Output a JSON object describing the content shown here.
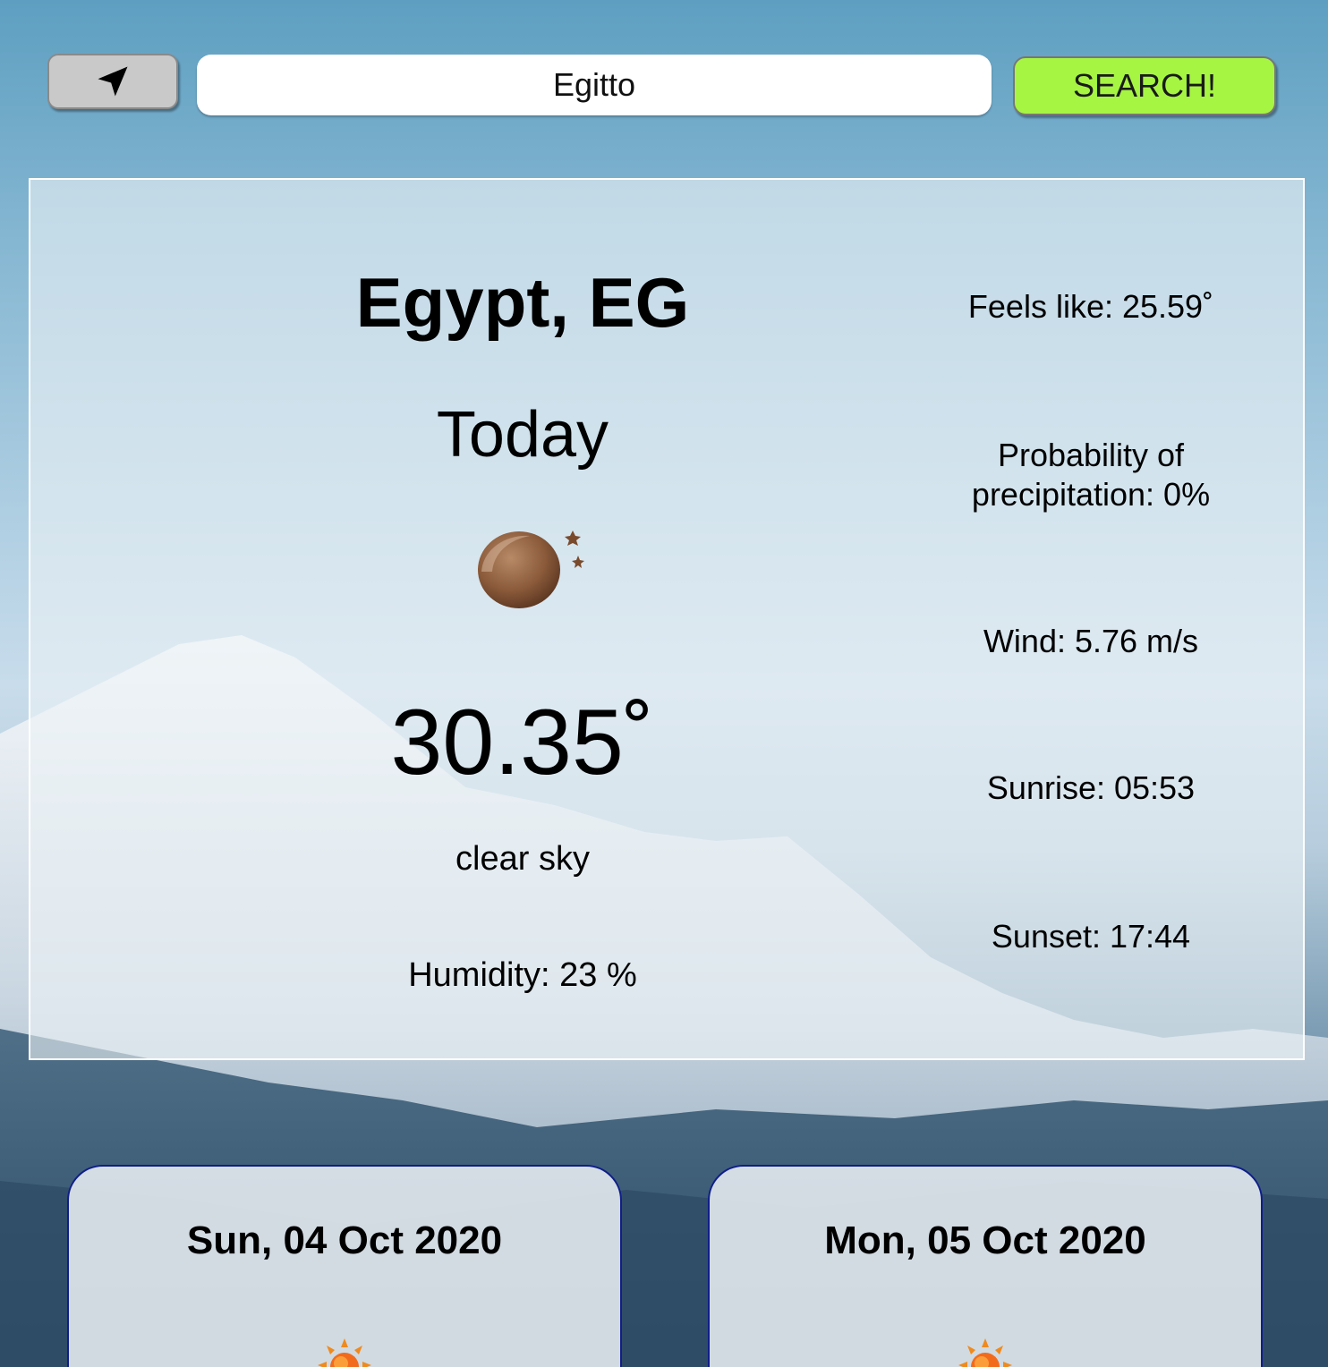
{
  "toolbar": {
    "location_icon": "location-arrow-icon",
    "search_value": "Egitto",
    "search_button_label": "SEARCH!",
    "search_button_color": "#a6f542"
  },
  "today": {
    "city": "Egypt, EG",
    "day_label": "Today",
    "icon": "clear-night-moon-icon",
    "temperature": "30.35˚",
    "description": "clear sky",
    "humidity": "Humidity: 23 %",
    "feels_like": "Feels like: 25.59˚",
    "precipitation": "Probability of precipitation: 0%",
    "wind": "Wind: 5.76 m/s",
    "sunrise": "Sunrise: 05:53",
    "sunset": "Sunset: 17:44"
  },
  "forecast": [
    {
      "date": "Sun, 04 Oct 2020",
      "icon": "sun-icon"
    },
    {
      "date": "Mon, 05 Oct 2020",
      "icon": "sun-icon"
    }
  ],
  "colors": {
    "card_border": "#ffffff",
    "forecast_border": "#0f1e8a"
  }
}
